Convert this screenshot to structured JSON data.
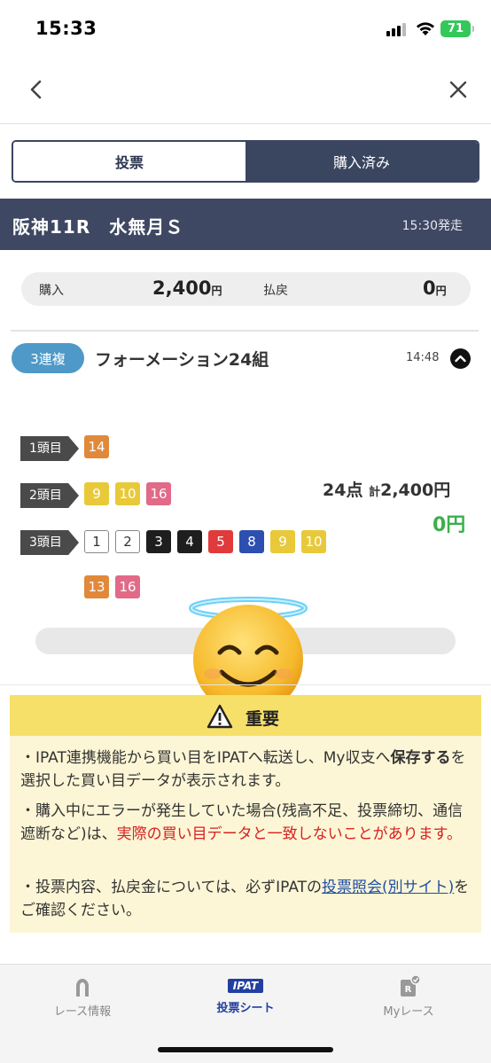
{
  "status_bar": {
    "time": "15:33",
    "battery": "71"
  },
  "segment": {
    "tab_vote": "投票",
    "tab_purchased": "購入済み"
  },
  "race": {
    "name": "阪神11R　水無月Ｓ",
    "post_time": "15:30発走"
  },
  "summary": {
    "purchase_label": "購入",
    "purchase_value": "2,400",
    "purchase_unit": "円",
    "refund_label": "払戻",
    "refund_value": "0",
    "refund_unit": "円"
  },
  "bet": {
    "type": "3連複",
    "title": "フォーメーション24組",
    "time": "14:48",
    "rows": [
      {
        "label": "1頭目",
        "horses": [
          "14"
        ]
      },
      {
        "label": "2頭目",
        "horses": [
          "9",
          "10",
          "16"
        ]
      },
      {
        "label": "3頭目",
        "horses": [
          "1",
          "2",
          "3",
          "4",
          "5",
          "8",
          "9",
          "10",
          "13",
          "16"
        ]
      }
    ],
    "points": "24点",
    "total_prefix": "計",
    "total": "2,400円",
    "payout": "0円"
  },
  "notice": {
    "title": "重要",
    "p1_a": "・IPAT連携機能から買い目をIPATへ転送し、My収支へ",
    "p1_b": "保存する",
    "p1_c": "を選択した買い目データが表示されます。",
    "p2_a": "・購入中にエラーが発生していた場合(残高不足、投票締切、通信遮断など)は、",
    "p2_b": "実際の買い目データと一致しないことがあります。",
    "p3_a": "・投票内容、払戻金については、必ずIPATの",
    "p3_link": "投票照会(別サイト)",
    "p3_b": "をご確認ください。"
  },
  "tabbar": {
    "race_info": "レース情報",
    "ipat_badge": "IPAT",
    "vote_sheet": "投票シート",
    "my_race": "Myレース"
  },
  "colors": {
    "navy": "#3e4862",
    "badge_blue": "#4f99c8",
    "payout_green": "#3cb04b",
    "warning_red": "#d72020",
    "notice_yellow": "#f7e06a"
  }
}
